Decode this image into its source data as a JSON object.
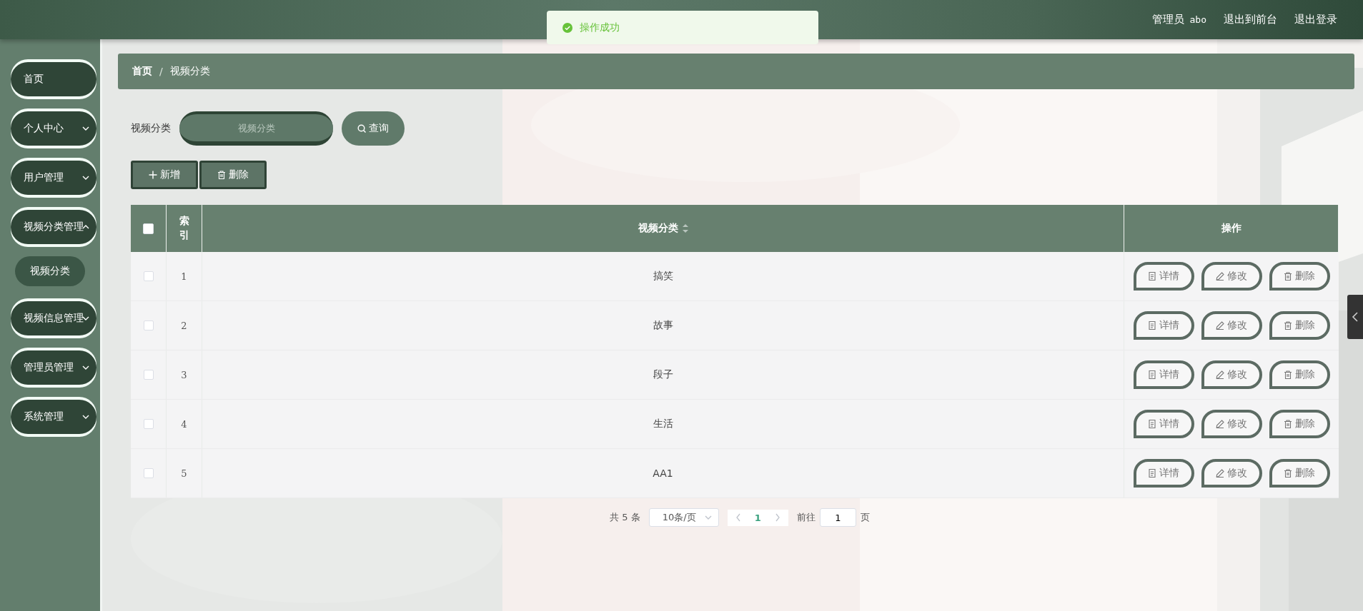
{
  "top_bar": {
    "user_label": "管理员",
    "username": "abo",
    "links": [
      "退出到前台",
      "退出登录"
    ]
  },
  "toast": {
    "kind": "success",
    "message": "操作成功"
  },
  "sidebar": {
    "items": [
      {
        "label": "首页",
        "kind": "link"
      },
      {
        "label": "个人中心",
        "kind": "submenu",
        "expanded": false
      },
      {
        "label": "用户管理",
        "kind": "submenu",
        "expanded": false
      },
      {
        "label": "视频分类管理",
        "kind": "submenu",
        "expanded": true,
        "children": [
          {
            "label": "视频分类"
          }
        ]
      },
      {
        "label": "视频信息管理",
        "kind": "submenu",
        "expanded": false
      },
      {
        "label": "管理员管理",
        "kind": "submenu",
        "expanded": false
      },
      {
        "label": "系统管理",
        "kind": "submenu",
        "expanded": false
      }
    ]
  },
  "breadcrumb": {
    "items": [
      "首页",
      "视频分类"
    ],
    "separator": "/"
  },
  "search": {
    "label": "视频分类",
    "placeholder": "视频分类",
    "button": "查询"
  },
  "actions": [
    {
      "label": "新增",
      "kind": "add"
    },
    {
      "label": "删除",
      "kind": "delete"
    }
  ],
  "table": {
    "columns": [
      {
        "kind": "select",
        "checked": false
      },
      {
        "kind": "index",
        "label": "索引"
      },
      {
        "kind": "text",
        "label": "视频分类",
        "sortable": true
      },
      {
        "kind": "actions",
        "label": "操作"
      }
    ],
    "rows": [
      {
        "checked": false,
        "index": "1",
        "category": "搞笑",
        "actions": [
          {
            "kind": "detail",
            "label": "详情"
          },
          {
            "kind": "edit",
            "label": "修改"
          },
          {
            "kind": "delete",
            "label": "删除"
          }
        ]
      },
      {
        "checked": false,
        "index": "2",
        "category": "故事",
        "actions": [
          {
            "kind": "detail",
            "label": "详情"
          },
          {
            "kind": "edit",
            "label": "修改"
          },
          {
            "kind": "delete",
            "label": "删除"
          }
        ]
      },
      {
        "checked": false,
        "index": "3",
        "category": "段子",
        "actions": [
          {
            "kind": "detail",
            "label": "详情"
          },
          {
            "kind": "edit",
            "label": "修改"
          },
          {
            "kind": "delete",
            "label": "删除"
          }
        ]
      },
      {
        "checked": false,
        "index": "4",
        "category": "生活",
        "actions": [
          {
            "kind": "detail",
            "label": "详情"
          },
          {
            "kind": "edit",
            "label": "修改"
          },
          {
            "kind": "delete",
            "label": "删除"
          }
        ]
      },
      {
        "checked": false,
        "index": "5",
        "category": "AA1",
        "actions": [
          {
            "kind": "detail",
            "label": "详情"
          },
          {
            "kind": "edit",
            "label": "修改"
          },
          {
            "kind": "delete",
            "label": "删除"
          }
        ]
      }
    ]
  },
  "pagination": {
    "total": "共 5 条",
    "page_size": "10条/页",
    "pages": [
      {
        "label": "1",
        "selected": true
      }
    ],
    "goto_label": "前往",
    "goto_value": "1",
    "goto_suffix": "页"
  }
}
